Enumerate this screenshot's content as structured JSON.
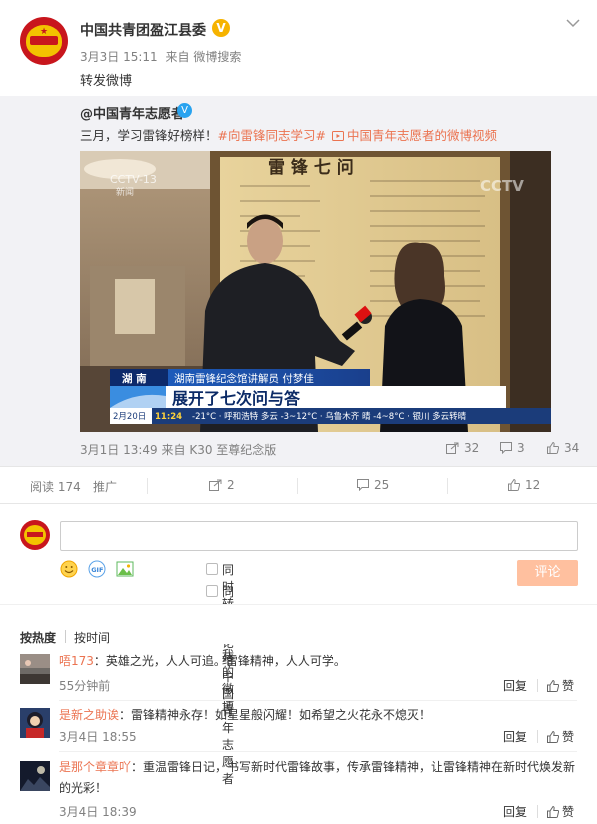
{
  "post": {
    "author": "中国共青团盈江县委",
    "date": "3月3日 15:11",
    "via_prefix": "来自",
    "via": "微博搜索",
    "text": "转发微博"
  },
  "forward": {
    "user": "@中国青年志愿者",
    "text_plain": "三月，学习雷锋好榜样！",
    "hashtag": "#向雷锋同志学习#",
    "video_link": "中国青年志愿者的微博视频",
    "date": "3月1日 13:49",
    "via_prefix": "来自",
    "via": "K30 至尊纪念版",
    "shares": "32",
    "comments": "3",
    "likes": "34",
    "video": {
      "board_title": "雷 锋 七 问",
      "channel_logo": "CCTV-13",
      "channel_sub": "新闻",
      "region": "湖 南",
      "lower_title": "湖南雷锋纪念馆讲解员 付梦佳",
      "headline": "展开了七次问与答",
      "ticker_date": "2月20日",
      "ticker_time": "11:24",
      "ticker_text": "-21°C · 呼和浩特 多云 -3~12°C · 乌鲁木齐 晴 -4~8°C · 银川 多云转晴"
    }
  },
  "stats": {
    "reads_label": "阅读",
    "reads": "174",
    "promote": "推广",
    "reposts": "2",
    "comments": "25",
    "likes": "12"
  },
  "composer": {
    "checkbox1": "同时转发到我的微博",
    "checkbox2": "同时评论给 中国青年志愿者",
    "submit": "评论"
  },
  "sort": {
    "hot": "按热度",
    "time": "按时间"
  },
  "comments": [
    {
      "name": "唔173",
      "text": "英雄之光，人人可追。雷锋精神，人人可学。",
      "time": "55分钟前",
      "reply": "回复",
      "like": "赞"
    },
    {
      "name": "是新之助诶",
      "text": "雷锋精神永存！如星星般闪耀！如希望之火花永不熄灭！",
      "time": "3月4日 18:55",
      "reply": "回复",
      "like": "赞"
    },
    {
      "name": "是那个章章吖",
      "text": "重温雷锋日记，书写新时代雷锋故事，传承雷锋精神，让雷锋精神在新时代焕发新的光彩！",
      "time": "3月4日 18:39",
      "reply": "回复",
      "like": "赞"
    }
  ]
}
